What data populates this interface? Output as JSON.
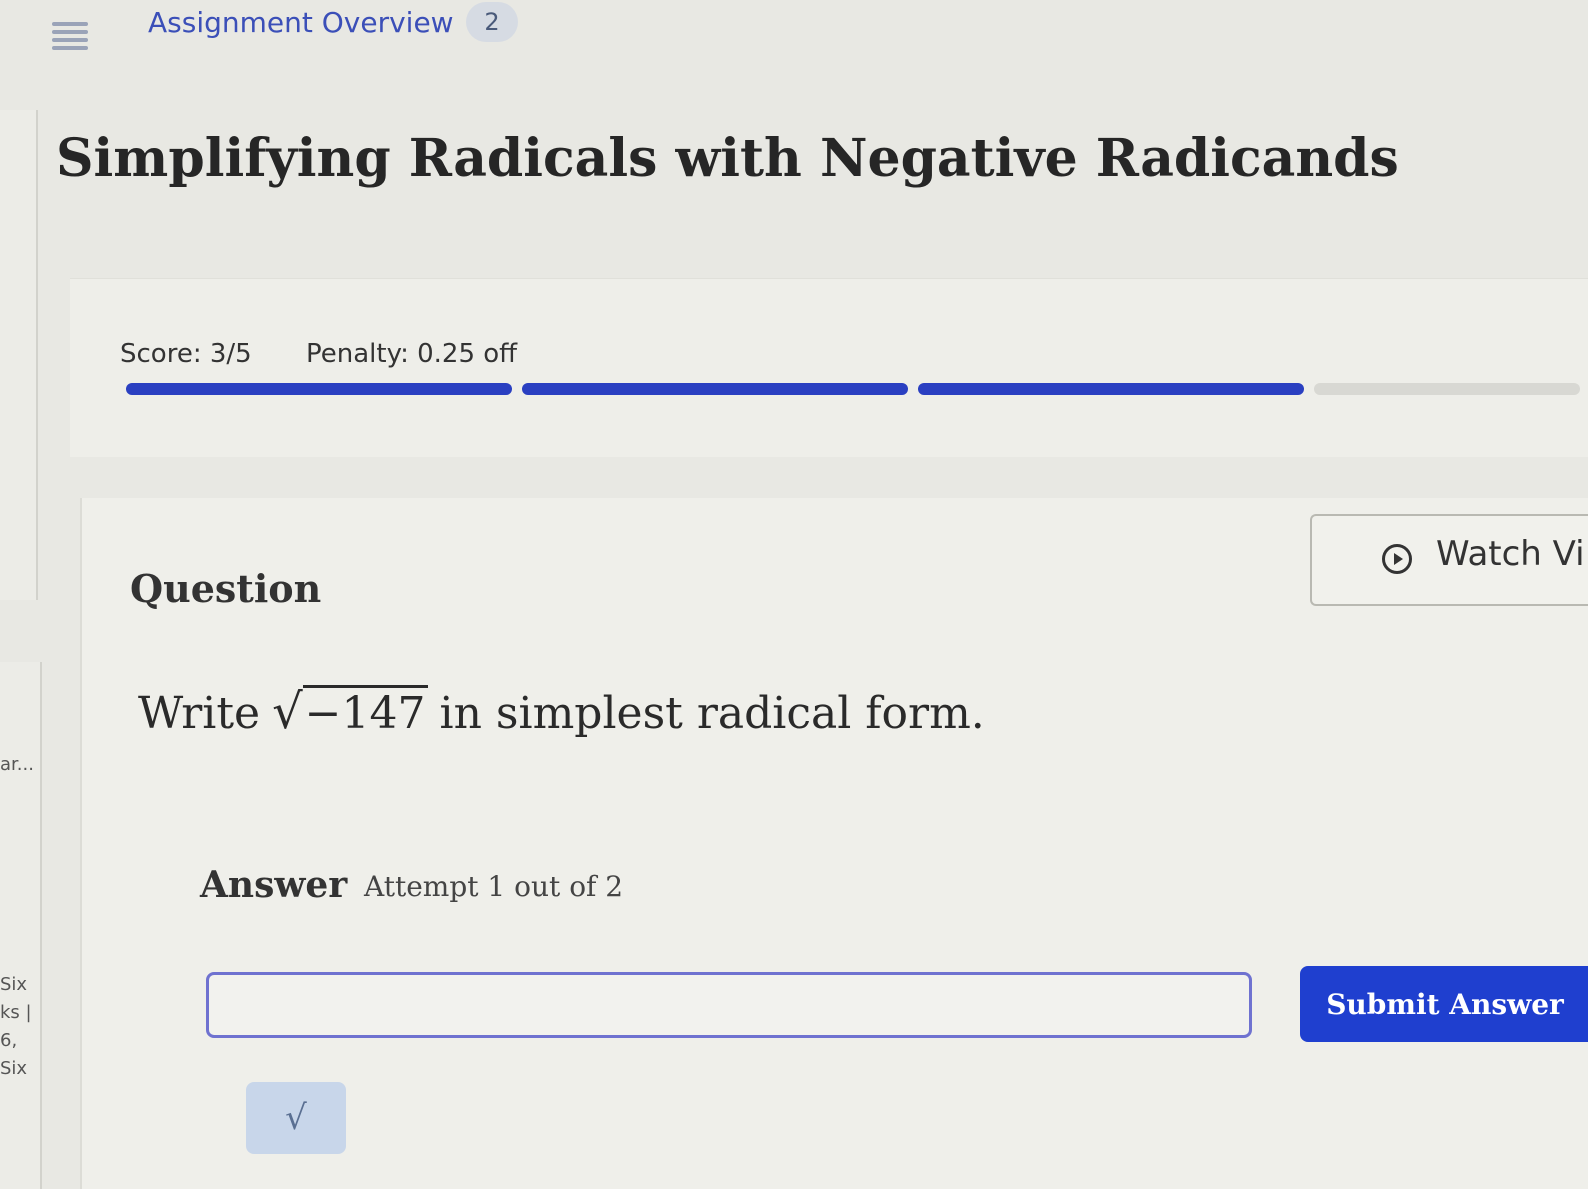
{
  "header": {
    "overview_label": "Assignment Overview",
    "overview_badge": "2"
  },
  "page": {
    "title": "Simplifying Radicals with Negative Radicands"
  },
  "left_sidebar": {
    "fragments": [
      "ar...",
      "Six",
      "ks |",
      "6,",
      "Six"
    ]
  },
  "score": {
    "score_text": "Score: 3/5",
    "penalty_text": "Penalty: 0.25 off",
    "progress": {
      "total_segments": 5,
      "completed_segments": 3,
      "fill_color": "#2a3fc1",
      "empty_color": "#d8d8d3"
    }
  },
  "question": {
    "label": "Question",
    "watch_video_label": "Watch Vi",
    "prompt_prefix": "Write",
    "radicand": "−147",
    "prompt_suffix": "in simplest radical form."
  },
  "answer": {
    "label": "Answer",
    "attempt_text": "Attempt 1 out of 2",
    "input_value": "",
    "submit_label": "Submit Answer",
    "sqrt_button_symbol": "√"
  },
  "colors": {
    "accent": "#1f3fcf",
    "link": "#3b4fb8",
    "input_border": "#6f72d0"
  }
}
